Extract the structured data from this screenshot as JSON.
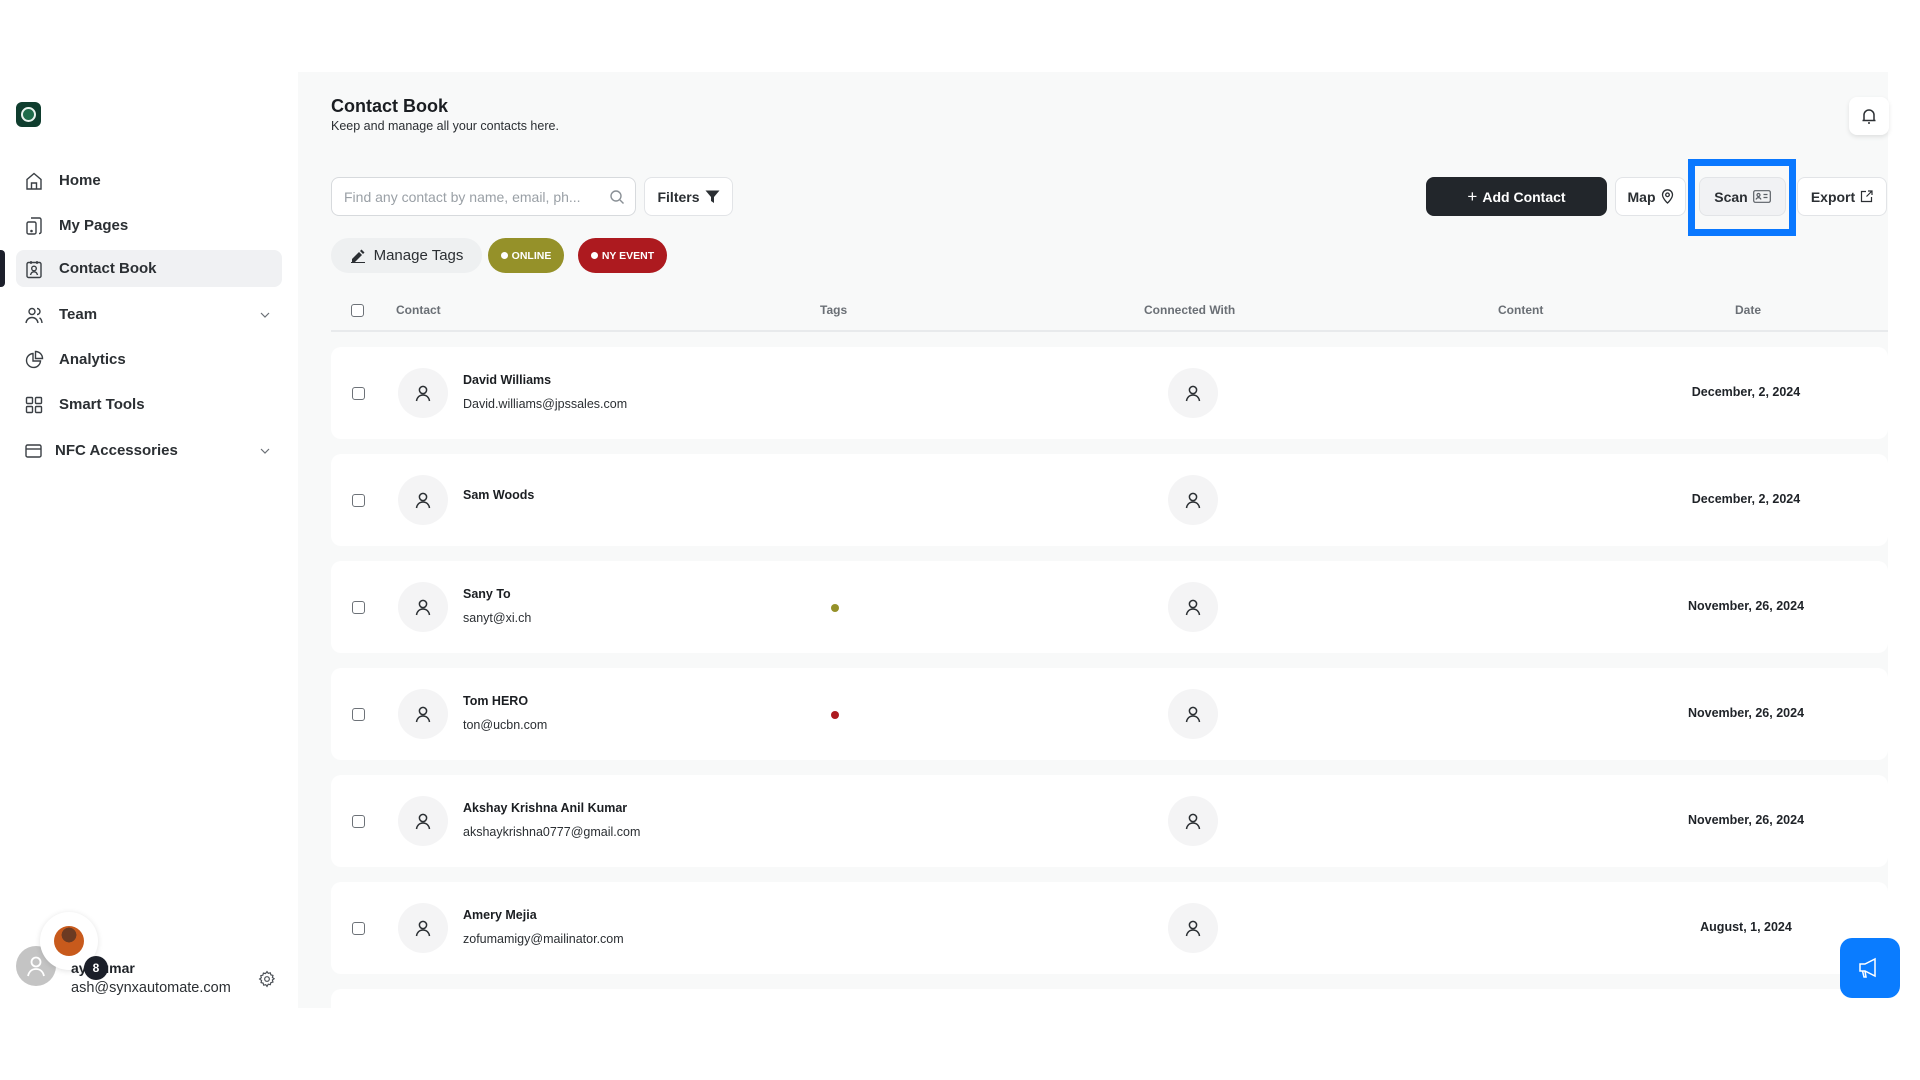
{
  "sidebar": {
    "logo": "starbucks-logo",
    "items": [
      {
        "label": "Home",
        "icon": "home-icon",
        "active": false
      },
      {
        "label": "My Pages",
        "icon": "pages-icon",
        "active": false
      },
      {
        "label": "Contact Book",
        "icon": "contact-book-icon",
        "active": true
      },
      {
        "label": "Team",
        "icon": "team-icon",
        "active": false,
        "expandable": true
      },
      {
        "label": "Analytics",
        "icon": "analytics-icon",
        "active": false
      },
      {
        "label": "Smart Tools",
        "icon": "grid-icon",
        "active": false
      },
      {
        "label": "NFC Accessories",
        "icon": "card-icon",
        "active": false,
        "expandable": true
      }
    ],
    "user": {
      "name": "ay Kumar",
      "email": "ash@synxautomate.com",
      "badge": "8"
    }
  },
  "header": {
    "title": "Contact Book",
    "subtitle": "Keep and manage all your contacts here."
  },
  "toolbar": {
    "search_placeholder": "Find any contact by name, email, ph...",
    "filters_label": "Filters",
    "add_contact_label": "Add Contact",
    "map_label": "Map",
    "scan_label": "Scan",
    "export_label": "Export"
  },
  "tags": {
    "manage_label": "Manage Tags",
    "items": [
      {
        "label": "ONLINE",
        "color": "#959129"
      },
      {
        "label": "NY EVENT",
        "color": "#ad1a1f"
      }
    ]
  },
  "table": {
    "columns": [
      "Contact",
      "Tags",
      "Connected With",
      "Content",
      "Date"
    ],
    "rows": [
      {
        "name": "David Williams",
        "email": "David.williams@jpssales.com",
        "tag_color": "",
        "date": "December, 2, 2024"
      },
      {
        "name": "Sam Woods",
        "email": "",
        "tag_color": "",
        "date": "December, 2, 2024"
      },
      {
        "name": "Sany To",
        "email": "sanyt@xi.ch",
        "tag_color": "#959129",
        "date": "November, 26, 2024"
      },
      {
        "name": "Tom HERO",
        "email": "ton@ucbn.com",
        "tag_color": "#ad1a1f",
        "date": "November, 26, 2024"
      },
      {
        "name": "Akshay Krishna Anil Kumar",
        "email": "akshaykrishna0777@gmail.com",
        "tag_color": "",
        "date": "November, 26, 2024"
      },
      {
        "name": "Amery Mejia",
        "email": "zofumamigy@mailinator.com",
        "tag_color": "",
        "date": "August, 1, 2024"
      }
    ]
  },
  "colors": {
    "accent_blue": "#0a7cff",
    "highlight": "#0a78ff",
    "dark_button": "#22262b"
  }
}
